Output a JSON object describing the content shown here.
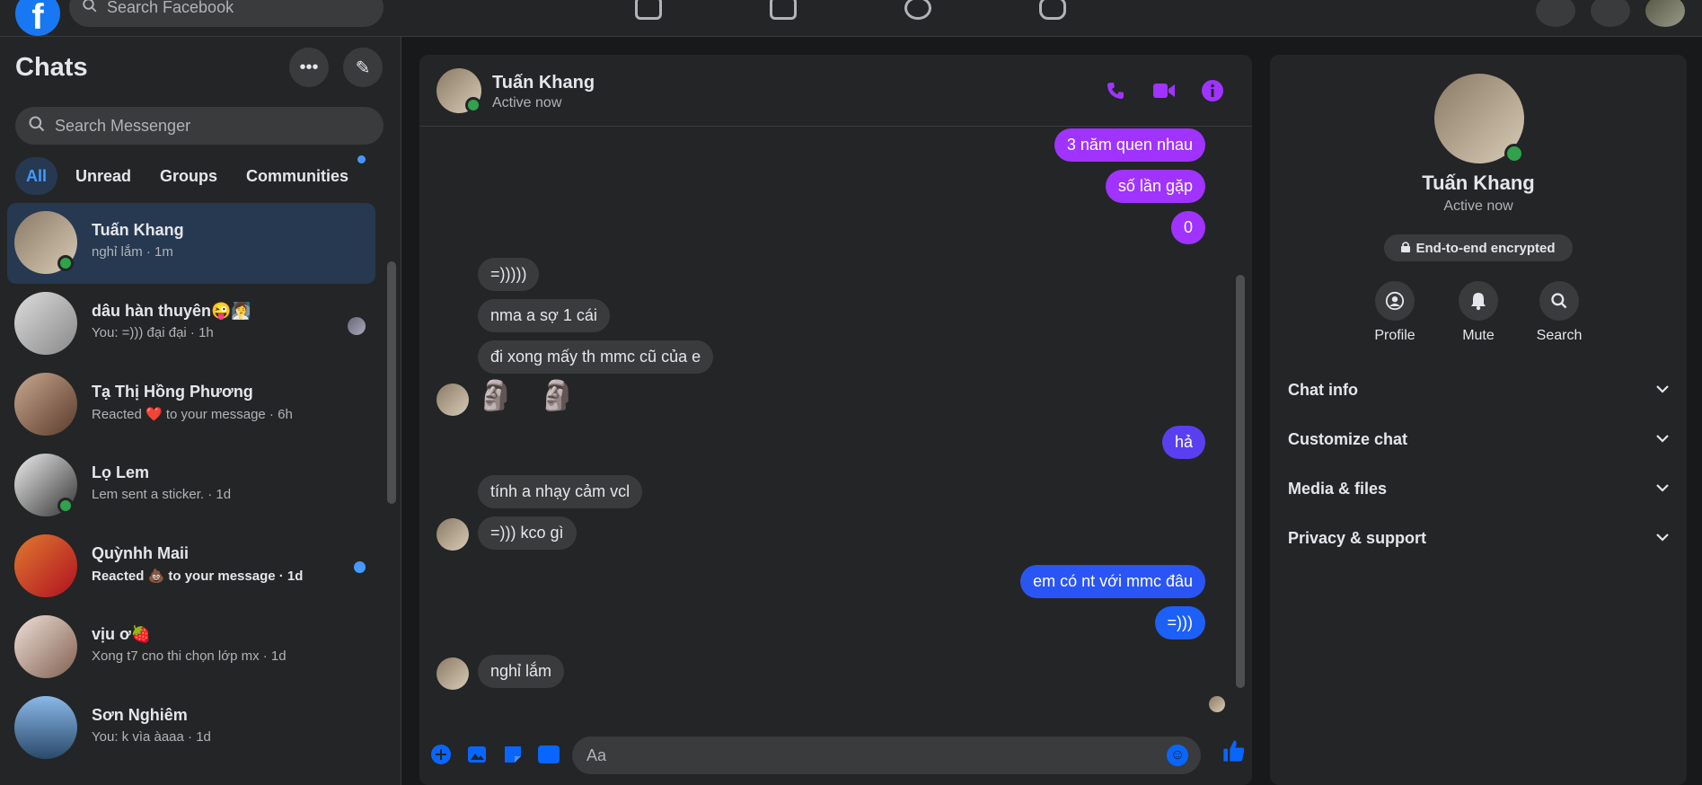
{
  "topbar": {
    "logo": "f",
    "search_placeholder": "Search Facebook",
    "nav_icons": [
      "home-icon",
      "watch-icon",
      "groups-icon",
      "gaming-icon"
    ],
    "right_icons": [
      "menu-grid-icon",
      "notifications-icon",
      "profile-avatar"
    ]
  },
  "sidebar": {
    "title": "Chats",
    "search_placeholder": "Search Messenger",
    "tabs": [
      "All",
      "Unread",
      "Groups",
      "Communities"
    ],
    "chats": [
      {
        "name": "Tuấn Khang",
        "preview": "nghỉ lắm · 1m",
        "online": true,
        "active": true
      },
      {
        "name": "dâu hàn thuyên😜🧖‍♀️",
        "preview": "You: =))) đại đại · 1h",
        "seen": true
      },
      {
        "name": "Tạ Thị Hồng Phương",
        "preview": "Reacted ❤️ to your message · 6h"
      },
      {
        "name": "Lọ Lem",
        "preview": "Lem sent a sticker. · 1d",
        "online": true
      },
      {
        "name": "Quỳnhh Maii",
        "preview": "Reacted 💩 to your message · 1d",
        "unread": true
      },
      {
        "name": "vịu ơ🍓",
        "preview": "Xong t7 cno thi chọn lớp mx · 1d"
      },
      {
        "name": "Sơn Nghiêm",
        "preview": "You: k vìa àaaa · 1d"
      }
    ]
  },
  "conversation": {
    "name": "Tuấn Khang",
    "status": "Active now",
    "messages": [
      {
        "text": "3 năm quen nhau",
        "dir": "out"
      },
      {
        "text": "số lần gặp",
        "dir": "out"
      },
      {
        "text": "0",
        "dir": "out"
      },
      {
        "text": "=)))))",
        "dir": "in"
      },
      {
        "text": "nma a sợ 1 cái",
        "dir": "in"
      },
      {
        "text": "đi xong mấy th mmc cũ của e",
        "dir": "in"
      },
      {
        "text": "🗿 🗿",
        "dir": "in"
      },
      {
        "text": "hả",
        "dir": "out"
      },
      {
        "text": "tính a nhạy cảm vcl",
        "dir": "in"
      },
      {
        "text": "=))) kco gì",
        "dir": "in"
      },
      {
        "text": "em có nt với mmc đâu",
        "dir": "out"
      },
      {
        "text": "=)))",
        "dir": "out"
      },
      {
        "text": "nghỉ lắm",
        "dir": "in"
      }
    ],
    "composer_placeholder": "Aa"
  },
  "right_panel": {
    "name": "Tuấn Khang",
    "status": "Active now",
    "encryption": "End-to-end encrypted",
    "actions": [
      "Profile",
      "Mute",
      "Search"
    ],
    "sections": [
      "Chat info",
      "Customize chat",
      "Media & files",
      "Privacy & support"
    ]
  },
  "colors": {
    "background": "#18191a",
    "panel": "#242526",
    "bubble_in": "#3a3b3c",
    "bubble_out_top": "#a033ff",
    "bubble_out_bottom": "#0866ff",
    "accent": "#a033ff",
    "online": "#31a24c"
  }
}
